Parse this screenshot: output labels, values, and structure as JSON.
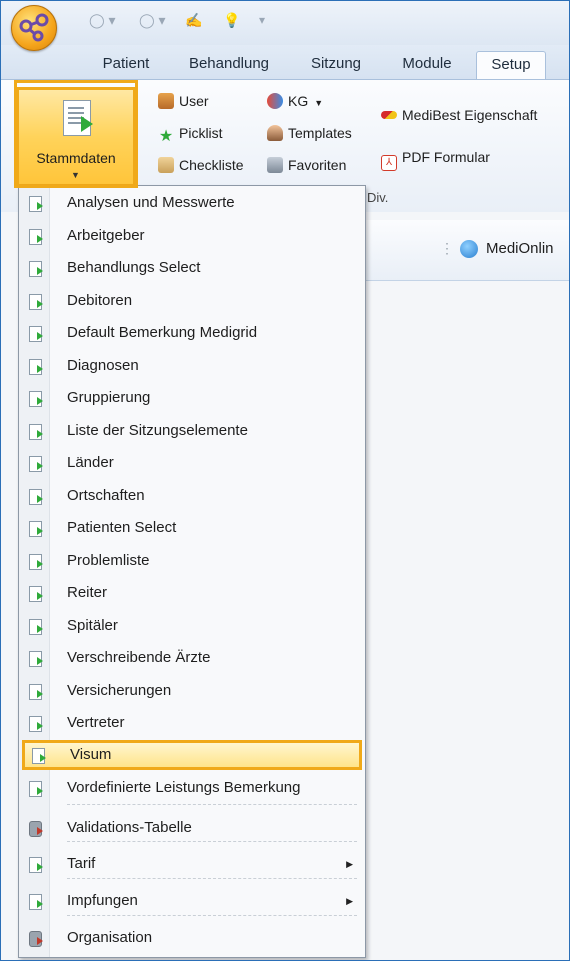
{
  "tabs": [
    {
      "label": "Patient"
    },
    {
      "label": "Behandlung"
    },
    {
      "label": "Sitzung"
    },
    {
      "label": "Module"
    },
    {
      "label": "Setup",
      "active": true
    }
  ],
  "ribbon": {
    "big_button": {
      "label": "Stammdaten",
      "icon": "document-arrow-icon"
    },
    "col1": [
      {
        "label": "User",
        "icon": "users-icon"
      },
      {
        "label": "Picklist",
        "icon": "star-icon"
      },
      {
        "label": "Checkliste",
        "icon": "checklist-icon"
      }
    ],
    "col2": [
      {
        "label": "KG",
        "icon": "kg-icon",
        "dropdown": true
      },
      {
        "label": "Templates",
        "icon": "template-icon"
      },
      {
        "label": "Favoriten",
        "icon": "favorites-icon"
      }
    ],
    "col3": [
      {
        "label": "MediBest Eigenschaft",
        "icon": "pill-icon"
      },
      {
        "label": "PDF Formular",
        "icon": "pdf-icon"
      }
    ],
    "group_label": "Div."
  },
  "toolbar_right": {
    "label": "MediOnlin"
  },
  "menu": {
    "items": [
      {
        "label": "Analysen und Messwerte",
        "icon": "document-arrow-icon"
      },
      {
        "label": "Arbeitgeber",
        "icon": "document-arrow-icon"
      },
      {
        "label": "Behandlungs Select",
        "icon": "document-arrow-icon"
      },
      {
        "label": "Debitoren",
        "icon": "document-arrow-icon"
      },
      {
        "label": "Default Bemerkung Medigrid",
        "icon": "document-arrow-icon"
      },
      {
        "label": "Diagnosen",
        "icon": "document-arrow-icon"
      },
      {
        "label": "Gruppierung",
        "icon": "document-arrow-icon"
      },
      {
        "label": "Liste der Sitzungselemente",
        "icon": "document-arrow-icon"
      },
      {
        "label": "Länder",
        "icon": "document-arrow-icon"
      },
      {
        "label": "Ortschaften",
        "icon": "document-arrow-icon"
      },
      {
        "label": "Patienten Select",
        "icon": "document-arrow-icon"
      },
      {
        "label": "Problemliste",
        "icon": "document-arrow-icon"
      },
      {
        "label": "Reiter",
        "icon": "document-arrow-icon"
      },
      {
        "label": "Spitäler",
        "icon": "document-arrow-icon"
      },
      {
        "label": "Verschreibende Ärzte",
        "icon": "document-arrow-icon"
      },
      {
        "label": "Versicherungen",
        "icon": "document-arrow-icon"
      },
      {
        "label": "Vertreter",
        "icon": "document-arrow-icon"
      },
      {
        "label": "Visum",
        "icon": "document-arrow-icon",
        "highlighted": true
      },
      {
        "label": "Vordefinierte Leistungs Bemerkung",
        "icon": "document-arrow-icon"
      },
      {
        "label": "Validations-Tabelle",
        "icon": "database-icon"
      },
      {
        "label": "Tarif",
        "icon": "document-arrow-icon",
        "submenu": true
      },
      {
        "label": "Impfungen",
        "icon": "document-arrow-icon",
        "submenu": true
      },
      {
        "label": "Organisation",
        "icon": "database-icon"
      }
    ]
  }
}
